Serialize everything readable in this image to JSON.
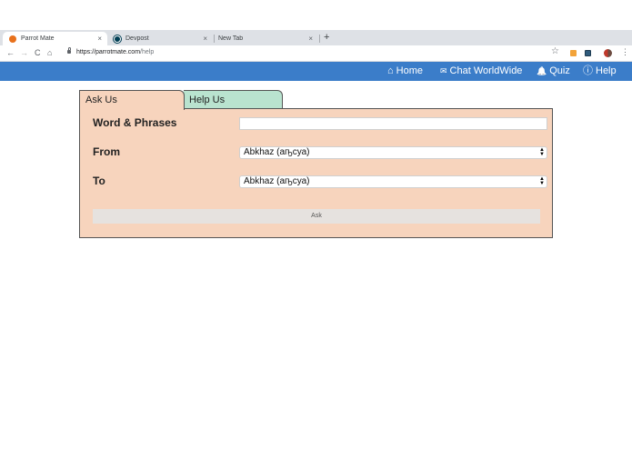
{
  "browser": {
    "tabs": [
      {
        "title": "Parrot Mate",
        "active": true,
        "favicon_color": "#e8711c"
      },
      {
        "title": "Devpost",
        "active": false,
        "favicon_color": "#003e54"
      },
      {
        "title": "New Tab",
        "active": false,
        "favicon_color": ""
      }
    ],
    "close_glyph": "×",
    "new_tab_glyph": "+",
    "nav": {
      "back": "←",
      "forward": "→",
      "reload": "C",
      "home": "⌂"
    },
    "url_host": "https://parrotmate.com",
    "url_path": "/help",
    "star_glyph": "☆",
    "menu_glyph": "⋮"
  },
  "site_nav": {
    "items": [
      {
        "icon": "⌂",
        "label": "Home"
      },
      {
        "icon": "✉",
        "label": "Chat WorldWide"
      },
      {
        "icon": "🔔",
        "label": "Quiz"
      },
      {
        "icon": "ⓘ",
        "label": "Help"
      }
    ],
    "bg_color": "#3b7dc9"
  },
  "form": {
    "tabs": [
      {
        "label": "Ask Us",
        "color": "#f7d4bd"
      },
      {
        "label": "Help Us",
        "color": "#b9e3cf"
      }
    ],
    "word_label": "Word & Phrases",
    "word_value": "",
    "from_label": "From",
    "from_value": "Abkhaz (аҧсуа)",
    "to_label": "To",
    "to_value": "Abkhaz (аҧсуа)",
    "ask_label": "Ask"
  }
}
